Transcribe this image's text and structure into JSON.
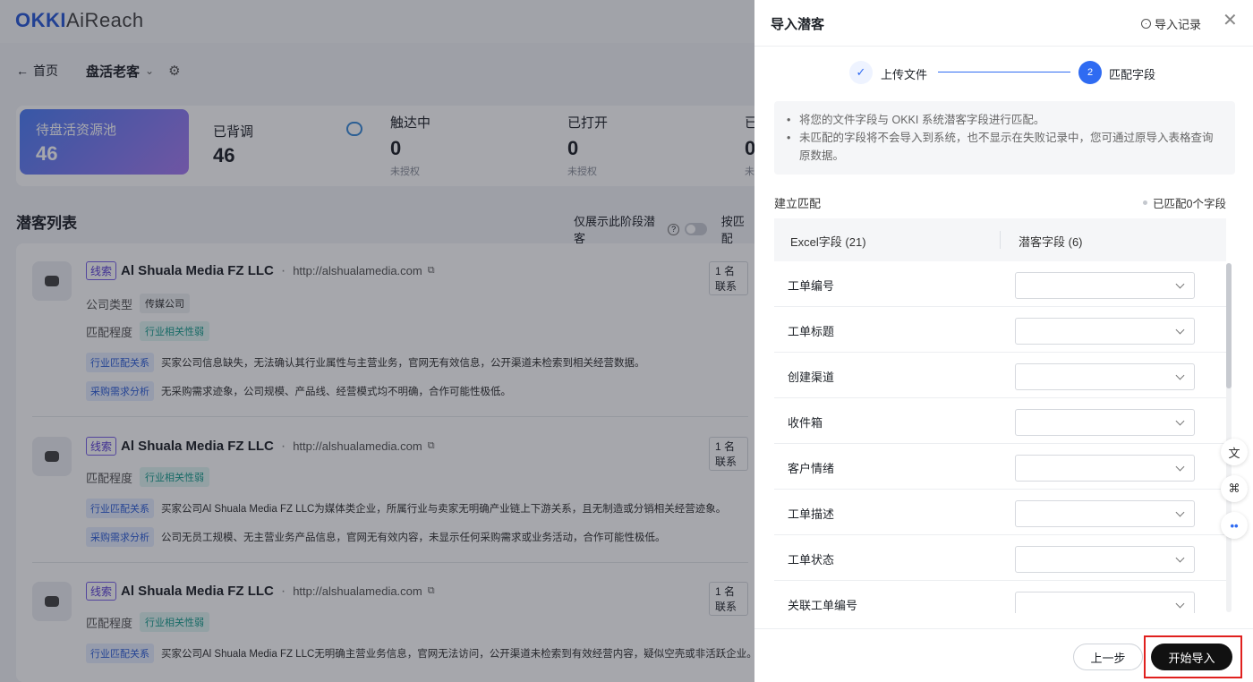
{
  "app": {
    "logo_main": "OKKI",
    "logo_sub": "AiReach",
    "back_label": "首页",
    "page_title": "盘活老客",
    "pool": {
      "title": "待盘活资源池",
      "value": "46"
    },
    "stats": [
      {
        "title": "已背调",
        "value": "46",
        "sub": ""
      },
      {
        "title": "触达中",
        "value": "0",
        "sub": "未授权"
      },
      {
        "title": "已打开",
        "value": "0",
        "sub": "未授权"
      },
      {
        "title": "已",
        "value": "0",
        "sub": "未"
      }
    ],
    "list_title": "潜客列表",
    "filter_label": "仅展示此阶段潜客",
    "filter_extra": "按匹配",
    "leads": [
      {
        "tag": "线索",
        "name": "Al Shuala Media FZ LLC",
        "url": "http://alshualamedia.com",
        "contact": "1 名联系",
        "company_type_label": "公司类型",
        "company_type": "传媒公司",
        "match_label": "匹配程度",
        "match": "行业相关性弱",
        "analyses": [
          {
            "tag": "行业匹配关系",
            "text": "买家公司信息缺失，无法确认其行业属性与主营业务，官网无有效信息，公开渠道未检索到相关经营数据。"
          },
          {
            "tag": "采购需求分析",
            "text": "无采购需求迹象，公司规模、产品线、经营模式均不明确，合作可能性极低。"
          }
        ]
      },
      {
        "tag": "线索",
        "name": "Al Shuala Media FZ LLC",
        "url": "http://alshualamedia.com",
        "contact": "1 名联系",
        "match_label": "匹配程度",
        "match": "行业相关性弱",
        "analyses": [
          {
            "tag": "行业匹配关系",
            "text": "买家公司Al Shuala Media FZ LLC为媒体类企业，所属行业与卖家无明确产业链上下游关系，且无制造或分销相关经营迹象。"
          },
          {
            "tag": "采购需求分析",
            "text": "公司无员工规模、无主营业务产品信息，官网无有效内容，未显示任何采购需求或业务活动，合作可能性极低。"
          }
        ]
      },
      {
        "tag": "线索",
        "name": "Al Shuala Media FZ LLC",
        "url": "http://alshualamedia.com",
        "contact": "1 名联系",
        "match_label": "匹配程度",
        "match": "行业相关性弱",
        "analyses": [
          {
            "tag": "行业匹配关系",
            "text": "买家公司Al Shuala Media FZ LLC无明确主营业务信息，官网无法访问，公开渠道未检索到有效经营内容，疑似空壳或非活跃企业。"
          }
        ]
      }
    ]
  },
  "drawer": {
    "title": "导入潜客",
    "record_label": "导入记录",
    "close_icon": "close-icon",
    "steps": [
      {
        "label": "上传文件",
        "state": "done"
      },
      {
        "label": "匹配字段",
        "number": "2",
        "state": "active"
      }
    ],
    "notes": [
      "将您的文件字段与 OKKI 系统潜客字段进行匹配。",
      "未匹配的字段将不会导入到系统，也不显示在失败记录中，您可通过原导入表格查询原数据。"
    ],
    "mapping_label": "建立匹配",
    "matched_count": "已匹配0个字段",
    "col_excel": "Excel字段 (21)",
    "col_lead": "潜客字段 (6)",
    "fields": [
      "工单编号",
      "工单标题",
      "创建渠道",
      "收件箱",
      "客户情绪",
      "工单描述",
      "工单状态",
      "关联工单编号"
    ],
    "btn_prev": "上一步",
    "btn_start": "开始导入",
    "accent": "#2f6bf2",
    "highlight_color": "#e0201e"
  }
}
